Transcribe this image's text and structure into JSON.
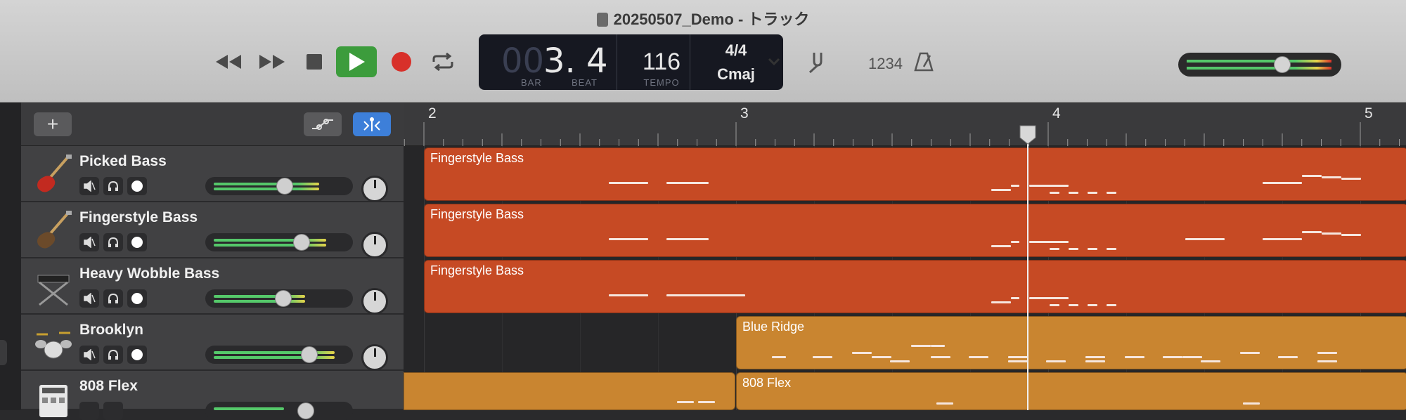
{
  "window": {
    "title": "20250507_Demo - トラック"
  },
  "lcd": {
    "position_dim": "00",
    "position_val": "3. 4",
    "bar_label": "BAR",
    "beat_label": "BEAT",
    "tempo": "116",
    "tempo_label": "TEMPO",
    "time_signature": "4/4",
    "key": "Cmaj"
  },
  "count_in": "1234",
  "master_volume": 0.65,
  "ruler": {
    "bars": [
      "2",
      "3",
      "4",
      "5"
    ]
  },
  "tracks": [
    {
      "name": "Picked Bass",
      "icon": "electric-bass-icon",
      "volume": 0.58
    },
    {
      "name": "Fingerstyle Bass",
      "icon": "electric-bass-icon",
      "volume": 0.73
    },
    {
      "name": "Heavy Wobble Bass",
      "icon": "synth-keyboard-icon",
      "volume": 0.57
    },
    {
      "name": "Brooklyn",
      "icon": "drum-kit-icon",
      "volume": 0.8
    },
    {
      "name": "808 Flex",
      "icon": "drum-machine-icon",
      "volume": 0.77
    }
  ],
  "regions": [
    {
      "name": "Fingerstyle Bass",
      "track": 0,
      "color": "#c64a24"
    },
    {
      "name": "Fingerstyle Bass",
      "track": 1,
      "color": "#c64a24"
    },
    {
      "name": "Fingerstyle Bass",
      "track": 2,
      "color": "#c64a24"
    },
    {
      "name": "Blue Ridge",
      "track": 3,
      "color": "#c98530"
    },
    {
      "name": "808 Flex",
      "track": 4,
      "color": "#c98530"
    }
  ],
  "playhead": {
    "bar": 3,
    "beat": 4
  },
  "colors": {
    "play": "#3c9c3c",
    "record": "#d8302a",
    "bass_region": "#c64a24",
    "drum_region": "#c98530",
    "smart_tempo_active": "#3d7fd9"
  }
}
